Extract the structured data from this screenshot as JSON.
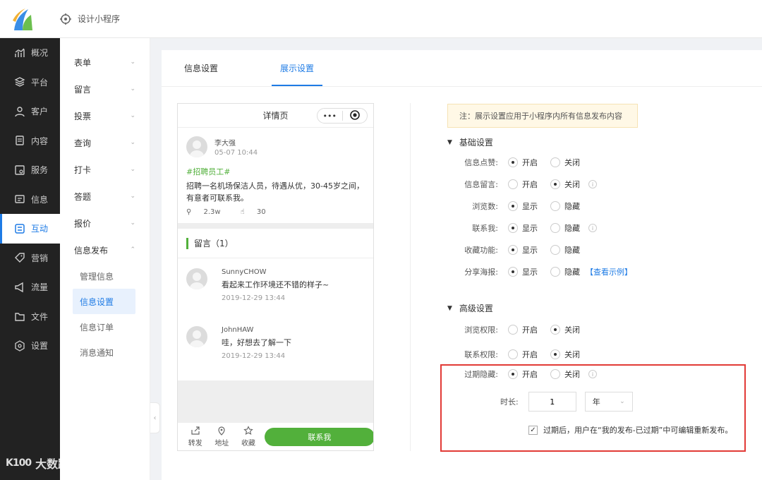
{
  "header": {
    "title": "设计小程序"
  },
  "sidebar": {
    "items": [
      {
        "label": "概况",
        "icon": "chart-icon"
      },
      {
        "label": "平台",
        "icon": "layers-icon"
      },
      {
        "label": "客户",
        "icon": "user-icon"
      },
      {
        "label": "内容",
        "icon": "document-icon"
      },
      {
        "label": "服务",
        "icon": "service-icon"
      },
      {
        "label": "信息",
        "icon": "message-icon"
      },
      {
        "label": "互动",
        "icon": "interact-icon",
        "active": true
      },
      {
        "label": "营销",
        "icon": "tag-icon"
      },
      {
        "label": "流量",
        "icon": "megaphone-icon"
      },
      {
        "label": "文件",
        "icon": "folder-icon"
      },
      {
        "label": "设置",
        "icon": "settings-icon"
      }
    ]
  },
  "submenu": {
    "items": [
      "表单",
      "留言",
      "投票",
      "查询",
      "打卡",
      "答题",
      "报价",
      "信息发布"
    ],
    "children": [
      "管理信息",
      "信息设置",
      "信息订单",
      "消息通知"
    ],
    "active_child": "信息设置"
  },
  "tabs": [
    {
      "label": "信息设置",
      "active": false
    },
    {
      "label": "展示设置",
      "active": true
    }
  ],
  "phone": {
    "title": "详情页",
    "capsule_dots": "•••",
    "post": {
      "user": "李大强",
      "time": "05-07 10:44",
      "hashtag": "#招聘员工#",
      "text": "招聘一名机场保洁人员，待遇从优，30-45岁之间，有意者可联系我。",
      "views": "2.3w",
      "likes": "30"
    },
    "comments_title": "留言（1）",
    "comments": [
      {
        "name": "SunnyCHOW",
        "text": "看起来工作环境还不错的样子~",
        "time": "2019-12-29 13:44"
      },
      {
        "name": "JohnHAW",
        "text": "哇，好想去了解一下",
        "time": "2019-12-29 13:44"
      }
    ],
    "footer": {
      "share": "转发",
      "address": "地址",
      "favorite": "收藏",
      "contact": "联系我"
    }
  },
  "settings": {
    "note": "注：展示设置应用于小程序内所有信息发布内容",
    "basic_title": "基础设置",
    "basic": [
      {
        "label": "信息点赞:",
        "opt1": "开启",
        "opt2": "关闭",
        "selected": 1,
        "info": false
      },
      {
        "label": "信息留言:",
        "opt1": "开启",
        "opt2": "关闭",
        "selected": 2,
        "info": true
      },
      {
        "label": "浏览数:",
        "opt1": "显示",
        "opt2": "隐藏",
        "selected": 1,
        "info": false
      },
      {
        "label": "联系我:",
        "opt1": "显示",
        "opt2": "隐藏",
        "selected": 1,
        "info": true
      },
      {
        "label": "收藏功能:",
        "opt1": "显示",
        "opt2": "隐藏",
        "selected": 1,
        "info": false
      },
      {
        "label": "分享海报:",
        "opt1": "显示",
        "opt2": "隐藏",
        "selected": 1,
        "info": false,
        "link": "【查看示例】"
      }
    ],
    "advanced_title": "高级设置",
    "advanced": [
      {
        "label": "浏览权限:",
        "opt1": "开启",
        "opt2": "关闭",
        "selected": 2,
        "info": false
      },
      {
        "label": "联系权限:",
        "opt1": "开启",
        "opt2": "关闭",
        "selected": 2,
        "info": false
      },
      {
        "label": "过期隐藏:",
        "opt1": "开启",
        "opt2": "关闭",
        "selected": 1,
        "info": true
      }
    ],
    "duration_label": "时长:",
    "duration_value": "1",
    "duration_unit": "年",
    "republish_text": "过期后，用户在“我的发布-已过期”中可编辑重新发布。",
    "info_glyph": "i",
    "check_glyph": "✓"
  },
  "watermark": {
    "logo": "K100",
    "text": "大数跨境"
  },
  "colors": {
    "accent": "#1e7be5",
    "green": "#52b03b",
    "highlight": "#e23a36"
  }
}
